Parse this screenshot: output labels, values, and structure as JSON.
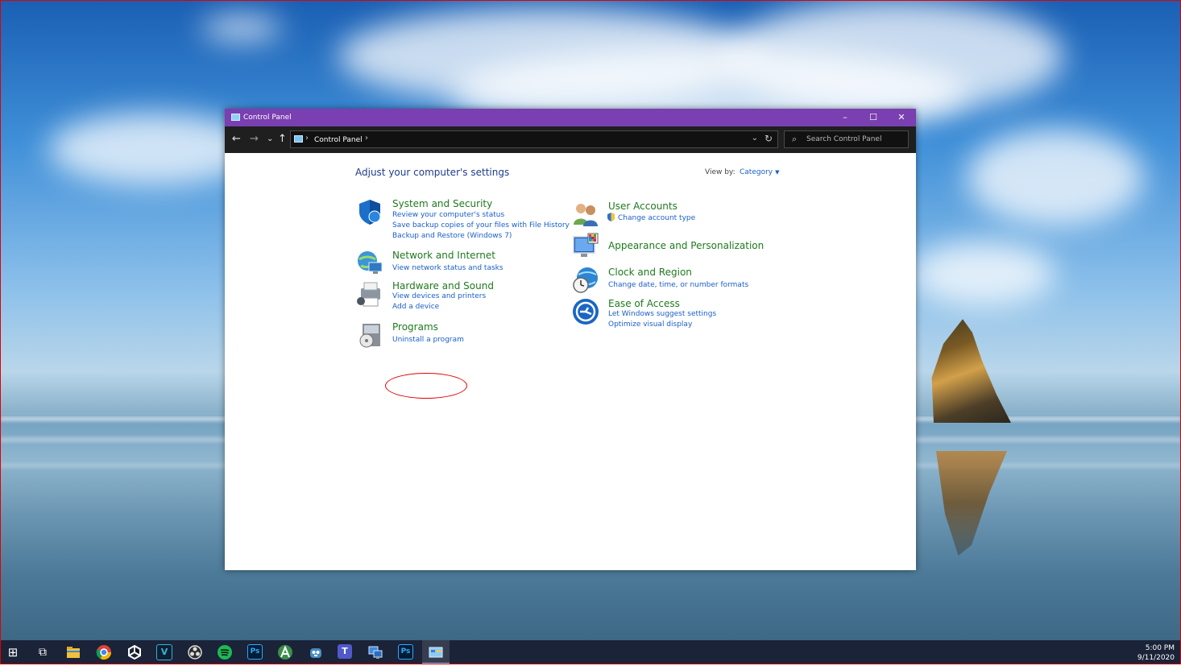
{
  "window": {
    "title": "Control Panel",
    "minimize": "–",
    "maximize": "☐",
    "close": "✕"
  },
  "address": {
    "back": "←",
    "forward": "→",
    "recent": "⌄",
    "up": "↑",
    "separator": "›",
    "breadcrumb": "Control Panel",
    "trail_separator": "›",
    "dropdown": "⌄",
    "refresh": "↻",
    "search_placeholder": "Search Control Panel",
    "search_glyph": "⌕"
  },
  "content": {
    "heading": "Adjust your computer's settings",
    "view_by_label": "View by:",
    "view_by_value": "Category",
    "caret": "▼"
  },
  "categories_left": [
    {
      "title": "System and Security",
      "links": [
        "Review your computer's status",
        "Save backup copies of your files with File History",
        "Backup and Restore (Windows 7)"
      ]
    },
    {
      "title": "Network and Internet",
      "links": [
        "View network status and tasks"
      ]
    },
    {
      "title": "Hardware and Sound",
      "links": [
        "View devices and printers",
        "Add a device"
      ]
    },
    {
      "title": "Programs",
      "links": [
        "Uninstall a program"
      ]
    }
  ],
  "categories_right": [
    {
      "title": "User Accounts",
      "links": [
        "Change account type"
      ]
    },
    {
      "title": "Appearance and Personalization",
      "links": []
    },
    {
      "title": "Clock and Region",
      "links": [
        "Change date, time, or number formats"
      ]
    },
    {
      "title": "Ease of Access",
      "links": [
        "Let Windows suggest settings",
        "Optimize visual display"
      ]
    }
  ],
  "taskbar": {
    "start_glyph": "⊞",
    "task_view_glyph": "⧉",
    "vegas_letter": "V",
    "ps_letter": "Ps",
    "ps2_letter": "Ps",
    "teams_letter": "T",
    "time": "5:00 PM",
    "date": "9/11/2020"
  },
  "colors": {
    "titlebar": "#7a3fb0",
    "category_title": "#1e7a1e",
    "link": "#1a5fc8",
    "heading": "#1e3c8c",
    "highlight": "#e00000"
  }
}
